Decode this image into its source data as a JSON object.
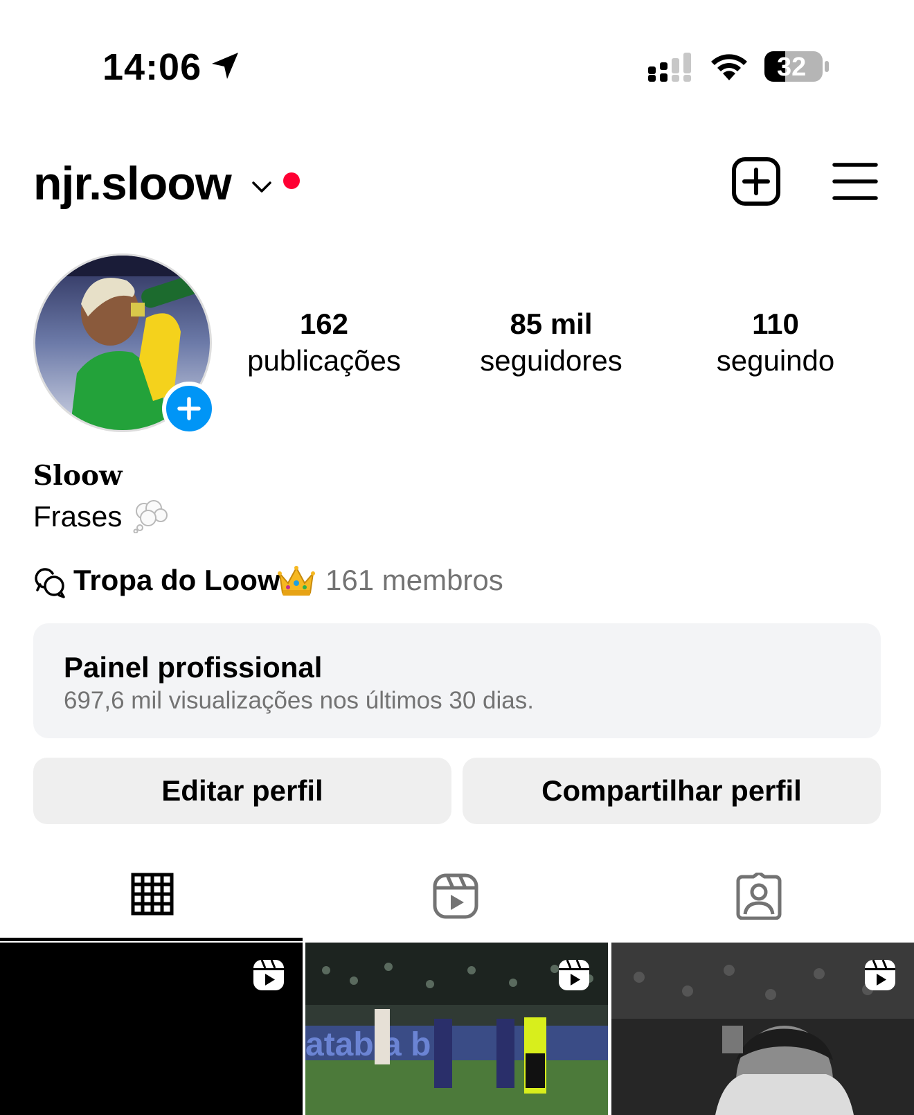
{
  "status_bar": {
    "time": "14:06",
    "battery": "32",
    "icons": [
      "location-arrow-icon",
      "signal-icon",
      "wifi-icon",
      "battery-icon"
    ]
  },
  "header": {
    "username": "njr.sloow",
    "icons": [
      "chevron-down-icon",
      "notification-dot",
      "new-post-icon",
      "menu-icon"
    ]
  },
  "profile": {
    "stats": [
      {
        "value": "162",
        "label": "publicações"
      },
      {
        "value": "85 mil",
        "label": "seguidores"
      },
      {
        "value": "110",
        "label": "seguindo"
      }
    ],
    "display_name": "Sloow",
    "bio": "Frases",
    "channel": {
      "name": "Tropa do Loow",
      "members": "161 membros"
    }
  },
  "dashboard": {
    "title": "Painel profissional",
    "subtitle": "697,6 mil visualizações nos últimos 30 dias."
  },
  "buttons": {
    "edit": "Editar perfil",
    "share": "Compartilhar perfil"
  },
  "tabs": [
    "grid-icon",
    "reels-icon",
    "tagged-icon"
  ],
  "grid": {
    "tiles": [
      "reel-tile",
      "reel-tile",
      "reel-tile"
    ]
  },
  "colors": {
    "accent": "#0095f6",
    "notification": "#ff0033",
    "secondary_text": "#737373",
    "button_bg": "#efefef"
  }
}
